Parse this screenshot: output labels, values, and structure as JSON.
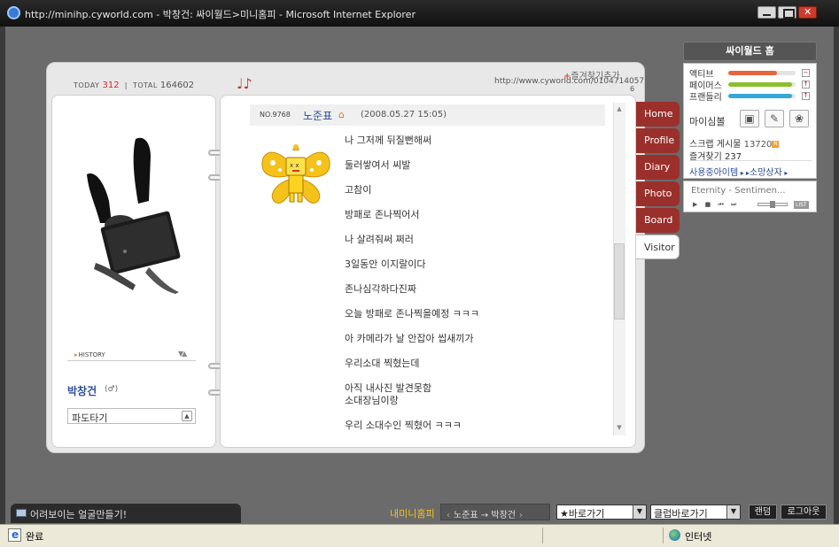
{
  "window": {
    "title": "http://minihp.cyworld.com - 박창건: 싸이월드>미니홈피 - Microsoft Internet Explorer"
  },
  "counter": {
    "today_label": "TODAY",
    "today_value": "312",
    "separator": "|",
    "total_label": "TOTAL",
    "total_value": "164602"
  },
  "header": {
    "music_icon": "♩♪",
    "fav_add_plus": "+",
    "fav_add_label": "즐겨찾기추가",
    "url": "http://www.cyworld.com/0104714057",
    "url_suffix": "6"
  },
  "profile": {
    "history_label": "HISTORY",
    "owner_name": "박창건",
    "gender": "(♂)",
    "mood_text": "파도타기"
  },
  "post": {
    "number": "NO.9768",
    "author": "노준표",
    "date": "(2008.05.27 15:05)",
    "lines": [
      "나 그저께 뒤질뻔해써",
      "둘러쌓여서 씨발",
      "고참이",
      "방패로 존나찍어서",
      "나 살려줘써 쩌러",
      "3일동안 이지랄이다",
      "존나심각하다진짜",
      "오늘 방패로 존나찍을예정 ㅋㅋㅋ",
      "아 카메라가 날 안잡아 씹새끼가",
      "우리소대 찍혔는데",
      "아직 내사진 발견못함",
      "소대장님이랑",
      "우리 소대수인 찍혔어 ㅋㅋㅋ"
    ]
  },
  "tabs": [
    {
      "label": "Home"
    },
    {
      "label": "Profile"
    },
    {
      "label": "Diary"
    },
    {
      "label": "Photo"
    },
    {
      "label": "Board"
    },
    {
      "label": "Visitor"
    }
  ],
  "sidebar": {
    "title": "싸이월드 홈",
    "stats": [
      {
        "label": "액티브",
        "level": 0.72,
        "color": "#e8643c",
        "button": "−"
      },
      {
        "label": "페이머스",
        "level": 0.95,
        "color": "#8bbf2e",
        "button": "↑"
      },
      {
        "label": "프랜들리",
        "level": 0.95,
        "color": "#34a8d8",
        "button": "↑"
      }
    ],
    "mood_label": "마이심볼",
    "tool_icons": [
      "radio-icon",
      "pen-icon",
      "hamster-icon"
    ],
    "scrap_label": "스크랩 게시물",
    "scrap_count": "13720",
    "scrap_badge": "N",
    "fav_label": "즐겨찾기",
    "fav_count": "237",
    "items_link": "사용중아이템",
    "wish_link": "소망상자"
  },
  "player": {
    "song": "Eternity - Sentimen...",
    "list_label": "LIST"
  },
  "bottom": {
    "tip": "어려보이는 얼굴만들기!",
    "my_mini": "내미니홈피",
    "crumb_from": "노준표",
    "crumb_arrow": "→",
    "crumb_to": "박창건",
    "go_label": "★바로가기",
    "club_label": "클럽바로가기",
    "random_label": "랜덤",
    "logout_label": "로그아웃"
  },
  "status": {
    "text": "완료",
    "zone": "인터넷"
  }
}
